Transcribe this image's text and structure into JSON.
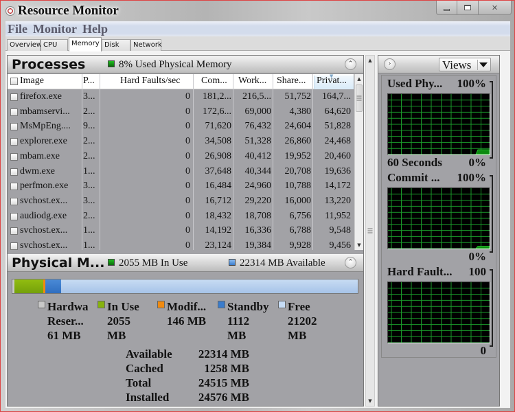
{
  "window": {
    "title": "Resource Monitor",
    "controls": [
      "minimize",
      "maximize",
      "close"
    ]
  },
  "menu": [
    "File",
    "Monitor",
    "Help"
  ],
  "tabs": [
    {
      "label": "Overview",
      "active": false
    },
    {
      "label": "CPU",
      "active": false
    },
    {
      "label": "Memory",
      "active": true
    },
    {
      "label": "Disk",
      "active": false
    },
    {
      "label": "Network",
      "active": false
    }
  ],
  "processes": {
    "title": "Processes",
    "status_text": "8% Used Physical Memory",
    "status_color": "#1f9e1f",
    "columns": [
      "Image",
      "P...",
      "Hard Faults/sec",
      "Com...",
      "Work...",
      "Share...",
      "Privat..."
    ],
    "sorted_column": "Privat...",
    "rows": [
      {
        "image": "firefox.exe",
        "pid": "3...",
        "hard_faults": "0",
        "commit": "181,2...",
        "working": "216,5...",
        "shareable": "51,752",
        "private": "164,7..."
      },
      {
        "image": "mbamservi...",
        "pid": "2...",
        "hard_faults": "0",
        "commit": "172,6...",
        "working": "69,000",
        "shareable": "4,380",
        "private": "64,620"
      },
      {
        "image": "MsMpEng....",
        "pid": "9...",
        "hard_faults": "0",
        "commit": "71,620",
        "working": "76,432",
        "shareable": "24,604",
        "private": "51,828"
      },
      {
        "image": "explorer.exe",
        "pid": "2...",
        "hard_faults": "0",
        "commit": "34,508",
        "working": "51,328",
        "shareable": "26,860",
        "private": "24,468"
      },
      {
        "image": "mbam.exe",
        "pid": "2...",
        "hard_faults": "0",
        "commit": "26,908",
        "working": "40,412",
        "shareable": "19,952",
        "private": "20,460"
      },
      {
        "image": "dwm.exe",
        "pid": "1...",
        "hard_faults": "0",
        "commit": "37,648",
        "working": "40,344",
        "shareable": "20,708",
        "private": "19,636"
      },
      {
        "image": "perfmon.exe",
        "pid": "3...",
        "hard_faults": "0",
        "commit": "16,484",
        "working": "24,960",
        "shareable": "10,788",
        "private": "14,172"
      },
      {
        "image": "svchost.ex...",
        "pid": "3...",
        "hard_faults": "0",
        "commit": "16,712",
        "working": "29,220",
        "shareable": "16,000",
        "private": "13,220"
      },
      {
        "image": "audiodg.exe",
        "pid": "2...",
        "hard_faults": "0",
        "commit": "18,432",
        "working": "18,708",
        "shareable": "6,756",
        "private": "11,952"
      },
      {
        "image": "svchost.ex...",
        "pid": "1...",
        "hard_faults": "0",
        "commit": "14,192",
        "working": "16,336",
        "shareable": "6,788",
        "private": "9,548"
      },
      {
        "image": "svchost.ex...",
        "pid": "1...",
        "hard_faults": "0",
        "commit": "23,124",
        "working": "19,384",
        "shareable": "9,928",
        "private": "9,456"
      }
    ]
  },
  "physical_memory": {
    "title": "Physical M...",
    "in_use_text": "2055 MB In Use",
    "available_text": "22314 MB Available",
    "bar_segments": [
      {
        "name": "Hardware Reserved",
        "mb": 61,
        "color": "#c8c8c8"
      },
      {
        "name": "In Use",
        "mb": 2055,
        "color": "#86b20e"
      },
      {
        "name": "Modified",
        "mb": 146,
        "color": "#f08a10"
      },
      {
        "name": "Standby",
        "mb": 1112,
        "color": "#3a7ccc"
      },
      {
        "name": "Free",
        "mb": 21202,
        "color": "#bcd4ef"
      }
    ],
    "legend": [
      {
        "lines": [
          "Hardwa",
          "Reser...",
          "61 MB"
        ],
        "color": "#c8c8c8"
      },
      {
        "lines": [
          "In Use",
          "2055",
          "MB"
        ],
        "color": "#86b20e"
      },
      {
        "lines": [
          "Modif...",
          "146 MB"
        ],
        "color": "#f08a10"
      },
      {
        "lines": [
          "Standby",
          "1112",
          "MB"
        ],
        "color": "#3a7ccc"
      },
      {
        "lines": [
          "Free",
          "21202",
          "MB"
        ],
        "color": "#c6dcf5"
      }
    ],
    "summary": [
      {
        "label": "Available",
        "value": "22314 MB"
      },
      {
        "label": "Cached",
        "value": "1258 MB"
      },
      {
        "label": "Total",
        "value": "24515 MB"
      },
      {
        "label": "Installed",
        "value": "24576 MB"
      }
    ]
  },
  "graphs": {
    "views_label": "Views",
    "items": [
      {
        "title": "Used Phy...",
        "max": "100%",
        "min": "0%",
        "sublabel": "60 Seconds",
        "current_fraction": 0.08
      },
      {
        "title": "Commit ...",
        "max": "100%",
        "min": "0%",
        "sublabel": "",
        "current_fraction": 0.04
      },
      {
        "title": "Hard Fault...",
        "max": "100",
        "min": "0",
        "sublabel": "",
        "current_fraction": 0.0
      }
    ]
  }
}
